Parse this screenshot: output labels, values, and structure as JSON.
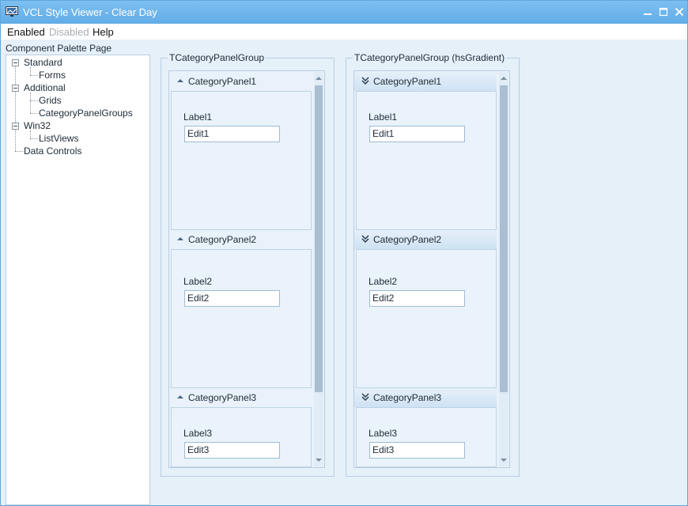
{
  "window": {
    "title": "VCL Style Viewer - Clear Day",
    "controls": {
      "minimize": "minimize-icon",
      "maximize": "maximize-icon",
      "close": "close-icon"
    }
  },
  "menu": {
    "items": [
      {
        "label": "Enabled",
        "disabled": false
      },
      {
        "label": "Disabled",
        "disabled": true
      },
      {
        "label": "Help",
        "disabled": false
      }
    ]
  },
  "palette": {
    "label": "Component Palette Page",
    "tree": [
      {
        "label": "Standard",
        "expanded": true,
        "children": [
          "Forms"
        ]
      },
      {
        "label": "Additional",
        "expanded": true,
        "children": [
          "Grids",
          "CategoryPanelGroups"
        ]
      },
      {
        "label": "Win32",
        "expanded": true,
        "children": [
          "ListViews"
        ]
      },
      {
        "label": "Data Controls",
        "expanded": false,
        "children": []
      }
    ]
  },
  "groups": [
    {
      "caption": "TCategoryPanelGroup",
      "header_style": "solid",
      "panels": [
        {
          "title": "CategoryPanel1",
          "label": "Label1",
          "edit": "Edit1"
        },
        {
          "title": "CategoryPanel2",
          "label": "Label2",
          "edit": "Edit2"
        },
        {
          "title": "CategoryPanel3",
          "label": "Label3",
          "edit": "Edit3"
        }
      ]
    },
    {
      "caption": "TCategoryPanelGroup (hsGradient)",
      "header_style": "gradient",
      "panels": [
        {
          "title": "CategoryPanel1",
          "label": "Label1",
          "edit": "Edit1"
        },
        {
          "title": "CategoryPanel2",
          "label": "Label2",
          "edit": "Edit2"
        },
        {
          "title": "CategoryPanel3",
          "label": "Label3",
          "edit": "Edit3"
        }
      ]
    }
  ],
  "colors": {
    "titlebar": "#6fb4ea",
    "client": "#e6f0f9",
    "accent": "#4d8ac4"
  }
}
